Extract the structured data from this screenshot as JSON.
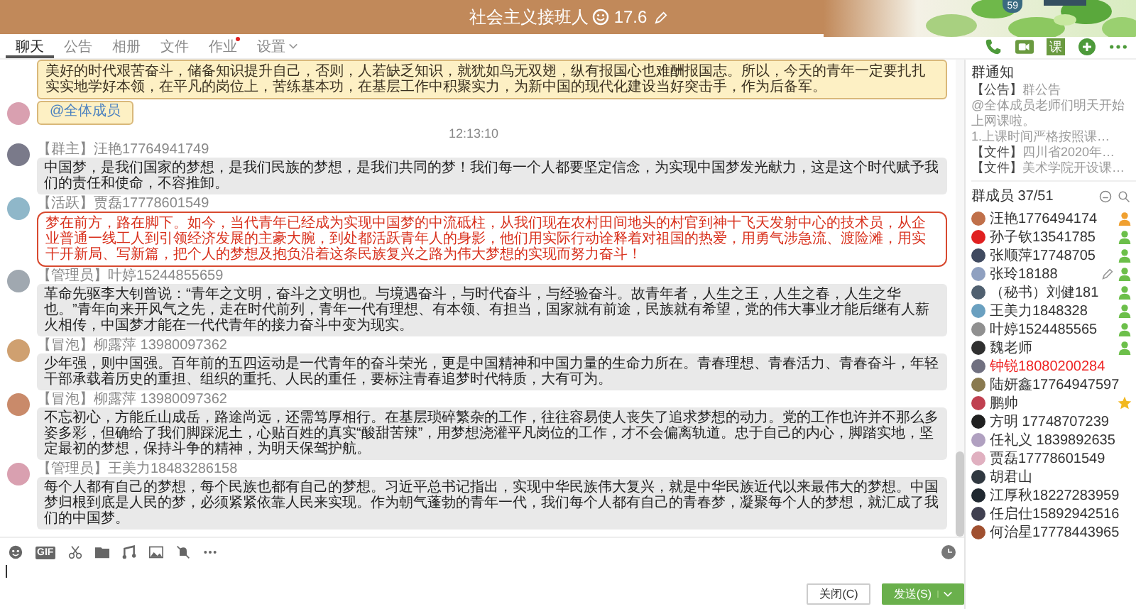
{
  "header": {
    "title": "社会主义接班人",
    "rank_text": "17.6",
    "badge": "59"
  },
  "tabs": [
    {
      "label": "聊天",
      "selected": true
    },
    {
      "label": "公告",
      "selected": false
    },
    {
      "label": "相册",
      "selected": false
    },
    {
      "label": "文件",
      "selected": false
    },
    {
      "label": "作业",
      "selected": false,
      "dot": true
    },
    {
      "label": "设置",
      "selected": false,
      "dropdown": true
    }
  ],
  "actions": {
    "lesson_label": "课"
  },
  "messages": [
    {
      "kind": "notice",
      "text": "美好的时代艰苦奋斗，储备知识提升自己，否则，人若缺乏知识，就犹如鸟无双翅，纵有报国心也难酬报国志。所以，今天的青年一定要扎扎实实地学好本领，在平凡的岗位上，苦练基本功，在基层工作中积聚实力，为新中国的现代化建设当好突击手，作为后备军。"
    },
    {
      "kind": "mention",
      "text": "@全体成员"
    },
    {
      "kind": "time",
      "text": "12:13:10"
    },
    {
      "kind": "normal",
      "sender": "【群主】汪艳17764941749",
      "text": "中国梦，是我们国家的梦想，是我们民族的梦想，是我们共同的梦！我们每一个人都要坚定信念，为实现中国梦发光献力，这是这个时代赋予我们的责任和使命，不容推卸。"
    },
    {
      "kind": "highlight",
      "sender": "【活跃】贾磊17778601549",
      "text": "梦在前方，路在脚下。如今，当代青年已经成为实现中国梦的中流砥柱，从我们现在农村田间地头的村官到神十飞天发射中心的技术员，从企业普通一线工人到引领经济发展的主豪大腕，到处都活跃青年人的身影，他们用实际行动诠释着对祖国的热爱，用勇气涉急流、渡险滩，用实干开新局、写新篇，把个人的梦想及抱负沿着这条民族复兴之路为伟大梦想的实现而努力奋斗！"
    },
    {
      "kind": "normal",
      "sender": "【管理员】叶婷15244855659",
      "text": "革命先驱李大钊曾说：“青年之文明，奋斗之文明也。与境遇奋斗，与时代奋斗，与经验奋斗。故青年者，人生之王，人生之春，人生之华也。”青年向来开风气之先，走在时代前列，青年一代有理想、有本领、有担当，国家就有前途，民族就有希望，党的伟大事业才能后继有人薪火相传，中国梦才能在一代代青年的接力奋斗中变为现实。"
    },
    {
      "kind": "normal",
      "sender": "【冒泡】柳露萍 13980097362",
      "text": "少年强，则中国强。百年前的五四运动是一代青年的奋斗荣光，更是中国精神和中国力量的生命力所在。青春理想、青春活力、青春奋斗，年轻干部承载着历史的重担、组织的重托、人民的重任，要标注青春追梦时代特质，大有可为。"
    },
    {
      "kind": "normal",
      "sender": "【冒泡】柳露萍 13980097362",
      "text": "不忘初心，方能丘山成岳，路途尚远，还需笃厚相行。在基层琐碎繁杂的工作，往往容易使人丧失了追求梦想的动力。党的工作也许并不那么多姿多彩，但确给了我们脚踩泥土，心贴百姓的真实“酸甜苦辣”，用梦想浇灌平凡岗位的工作，才不会偏离轨道。忠于自己的内心，脚踏实地，坚定最初的梦想，保持斗争的精神，为明天保驾护航。"
    },
    {
      "kind": "normal",
      "sender": "【管理员】王美力18483286158",
      "text": "每个人都有自己的梦想，每个民族也都有自己的梦想。习近平总书记指出，实现中华民族伟大复兴，就是中华民族近代以来最伟大的梦想。中国梦归根到底是人民的梦，必须紧紧依靠人民来实现。作为朝气蓬勃的青年一代，我们每个人都有自己的青春梦，凝聚每个人的梦想，就汇成了我们的中国梦。"
    }
  ],
  "composer": {
    "gif_label": "GIF",
    "close_button": "关闭(C)",
    "send_button": "发送(S)"
  },
  "notice_panel": {
    "title": "群通知",
    "items": [
      {
        "tag": "【公告】",
        "text": "群公告"
      },
      {
        "text": "@全体成员老师们明天开始上网课啦。"
      },
      {
        "text": "1.上课时间严格按照课…"
      },
      {
        "tag": "【文件】",
        "text": "四川省2020年…"
      },
      {
        "tag": "【文件】",
        "text": "美术学院开设课…"
      }
    ]
  },
  "members": {
    "title": "群成员",
    "count": "37/51",
    "items": [
      {
        "name": "汪艳1776494174",
        "owner": true
      },
      {
        "name": "孙子钦13541785",
        "admin": true
      },
      {
        "name": "张顺萍17748705",
        "admin": true
      },
      {
        "name": "张玲18188",
        "admin": true,
        "editable": true
      },
      {
        "name": "（秘书）刘健181",
        "admin": true
      },
      {
        "name": "王美力1848328",
        "admin": true
      },
      {
        "name": "叶婷1524485565",
        "admin": true
      },
      {
        "name": "魏老师",
        "admin": true
      },
      {
        "name": "钟锐18080200284",
        "color": "#ee2222"
      },
      {
        "name": "陆妍鑫17764947597"
      },
      {
        "name": "鹏帅",
        "starred": true
      },
      {
        "name": "方明 17748707239"
      },
      {
        "name": "任礼义 1839892635"
      },
      {
        "name": "贾磊17778601549"
      },
      {
        "name": "胡君山"
      },
      {
        "name": "江厚秋18227283959"
      },
      {
        "name": "任启仕15892942516"
      },
      {
        "name": "何治星17778443965"
      }
    ]
  }
}
